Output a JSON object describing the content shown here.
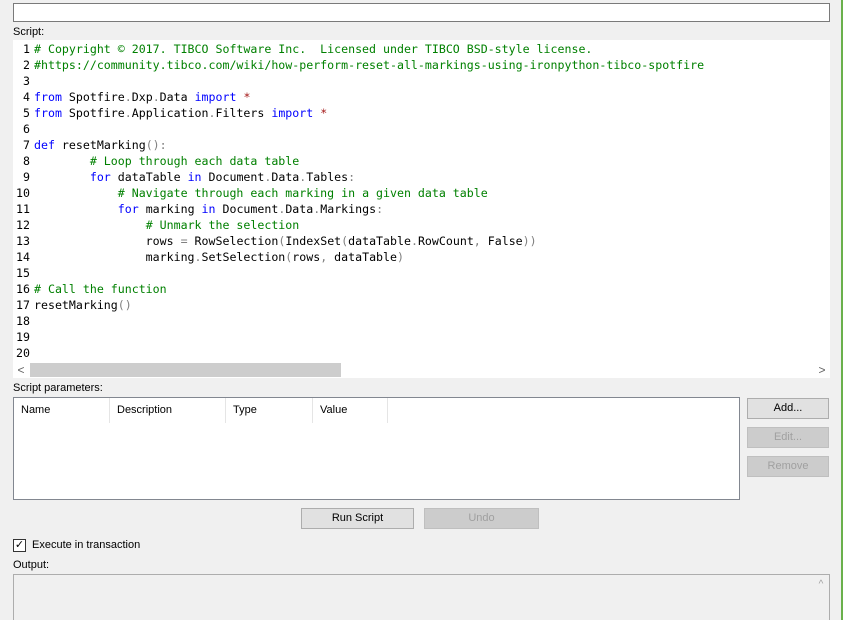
{
  "top_input": {
    "value": ""
  },
  "script_label": "Script:",
  "code_lines": [
    {
      "n": "1",
      "tokens": [
        {
          "t": "# Copyright © 2017. TIBCO Software Inc.  Licensed under TIBCO BSD-style license.",
          "c": "comment"
        }
      ]
    },
    {
      "n": "2",
      "tokens": [
        {
          "t": "#https://community.tibco.com/wiki/how-perform-reset-all-markings-using-ironpython-tibco-spotfire",
          "c": "comment"
        }
      ]
    },
    {
      "n": "3",
      "tokens": []
    },
    {
      "n": "4",
      "tokens": [
        {
          "t": "from",
          "c": "kw"
        },
        {
          "t": " Spotfire",
          "c": ""
        },
        {
          "t": ".",
          "c": "punc"
        },
        {
          "t": "Dxp",
          "c": ""
        },
        {
          "t": ".",
          "c": "punc"
        },
        {
          "t": "Data ",
          "c": ""
        },
        {
          "t": "import",
          "c": "kw"
        },
        {
          "t": " *",
          "c": "str"
        }
      ]
    },
    {
      "n": "5",
      "tokens": [
        {
          "t": "from",
          "c": "kw"
        },
        {
          "t": " Spotfire",
          "c": ""
        },
        {
          "t": ".",
          "c": "punc"
        },
        {
          "t": "Application",
          "c": ""
        },
        {
          "t": ".",
          "c": "punc"
        },
        {
          "t": "Filters ",
          "c": ""
        },
        {
          "t": "import",
          "c": "kw"
        },
        {
          "t": " *",
          "c": "str"
        }
      ]
    },
    {
      "n": "6",
      "tokens": []
    },
    {
      "n": "7",
      "tokens": [
        {
          "t": "def",
          "c": "kw"
        },
        {
          "t": " resetMarking",
          "c": ""
        },
        {
          "t": "():",
          "c": "punc"
        }
      ]
    },
    {
      "n": "8",
      "tokens": [
        {
          "t": "        ",
          "c": ""
        },
        {
          "t": "# Loop through each data table",
          "c": "comment"
        }
      ]
    },
    {
      "n": "9",
      "tokens": [
        {
          "t": "        ",
          "c": ""
        },
        {
          "t": "for",
          "c": "kw"
        },
        {
          "t": " dataTable ",
          "c": ""
        },
        {
          "t": "in",
          "c": "kw"
        },
        {
          "t": " Document",
          "c": ""
        },
        {
          "t": ".",
          "c": "punc"
        },
        {
          "t": "Data",
          "c": ""
        },
        {
          "t": ".",
          "c": "punc"
        },
        {
          "t": "Tables",
          "c": ""
        },
        {
          "t": ":",
          "c": "punc"
        }
      ]
    },
    {
      "n": "10",
      "tokens": [
        {
          "t": "            ",
          "c": ""
        },
        {
          "t": "# Navigate through each marking in a given data table",
          "c": "comment"
        }
      ]
    },
    {
      "n": "11",
      "tokens": [
        {
          "t": "            ",
          "c": ""
        },
        {
          "t": "for",
          "c": "kw"
        },
        {
          "t": " marking ",
          "c": ""
        },
        {
          "t": "in",
          "c": "kw"
        },
        {
          "t": " Document",
          "c": ""
        },
        {
          "t": ".",
          "c": "punc"
        },
        {
          "t": "Data",
          "c": ""
        },
        {
          "t": ".",
          "c": "punc"
        },
        {
          "t": "Markings",
          "c": ""
        },
        {
          "t": ":",
          "c": "punc"
        }
      ]
    },
    {
      "n": "12",
      "tokens": [
        {
          "t": "                ",
          "c": ""
        },
        {
          "t": "# Unmark the selection",
          "c": "comment"
        }
      ]
    },
    {
      "n": "13",
      "tokens": [
        {
          "t": "                rows ",
          "c": ""
        },
        {
          "t": "=",
          "c": "punc"
        },
        {
          "t": " RowSelection",
          "c": ""
        },
        {
          "t": "(",
          "c": "punc"
        },
        {
          "t": "IndexSet",
          "c": ""
        },
        {
          "t": "(",
          "c": "punc"
        },
        {
          "t": "dataTable",
          "c": ""
        },
        {
          "t": ".",
          "c": "punc"
        },
        {
          "t": "RowCount",
          "c": ""
        },
        {
          "t": ",",
          "c": "punc"
        },
        {
          "t": " False",
          "c": ""
        },
        {
          "t": "))",
          "c": "punc"
        }
      ]
    },
    {
      "n": "14",
      "tokens": [
        {
          "t": "                marking",
          "c": ""
        },
        {
          "t": ".",
          "c": "punc"
        },
        {
          "t": "SetSelection",
          "c": ""
        },
        {
          "t": "(",
          "c": "punc"
        },
        {
          "t": "rows",
          "c": ""
        },
        {
          "t": ",",
          "c": "punc"
        },
        {
          "t": " dataTable",
          "c": ""
        },
        {
          "t": ")",
          "c": "punc"
        }
      ]
    },
    {
      "n": "15",
      "tokens": []
    },
    {
      "n": "16",
      "tokens": [
        {
          "t": "# Call the function",
          "c": "comment"
        }
      ]
    },
    {
      "n": "17",
      "tokens": [
        {
          "t": "resetMarking",
          "c": ""
        },
        {
          "t": "()",
          "c": "punc"
        }
      ]
    },
    {
      "n": "18",
      "tokens": []
    },
    {
      "n": "19",
      "tokens": []
    },
    {
      "n": "20",
      "tokens": []
    }
  ],
  "scrollbar": {
    "left_arrow": "<",
    "right_arrow": ">",
    "up_arrow": "^"
  },
  "params_label": "Script parameters:",
  "params_columns": [
    "Name",
    "Description",
    "Type",
    "Value"
  ],
  "buttons": {
    "add": "Add...",
    "edit": "Edit...",
    "remove": "Remove",
    "run": "Run Script",
    "undo": "Undo"
  },
  "transaction": {
    "label": "Execute in transaction",
    "checked": true,
    "check_glyph": "✓"
  },
  "output_label": "Output:",
  "colors": {
    "comment": "#008000",
    "keyword": "#0000ff",
    "punctuation": "#808080",
    "string": "#a31515"
  }
}
